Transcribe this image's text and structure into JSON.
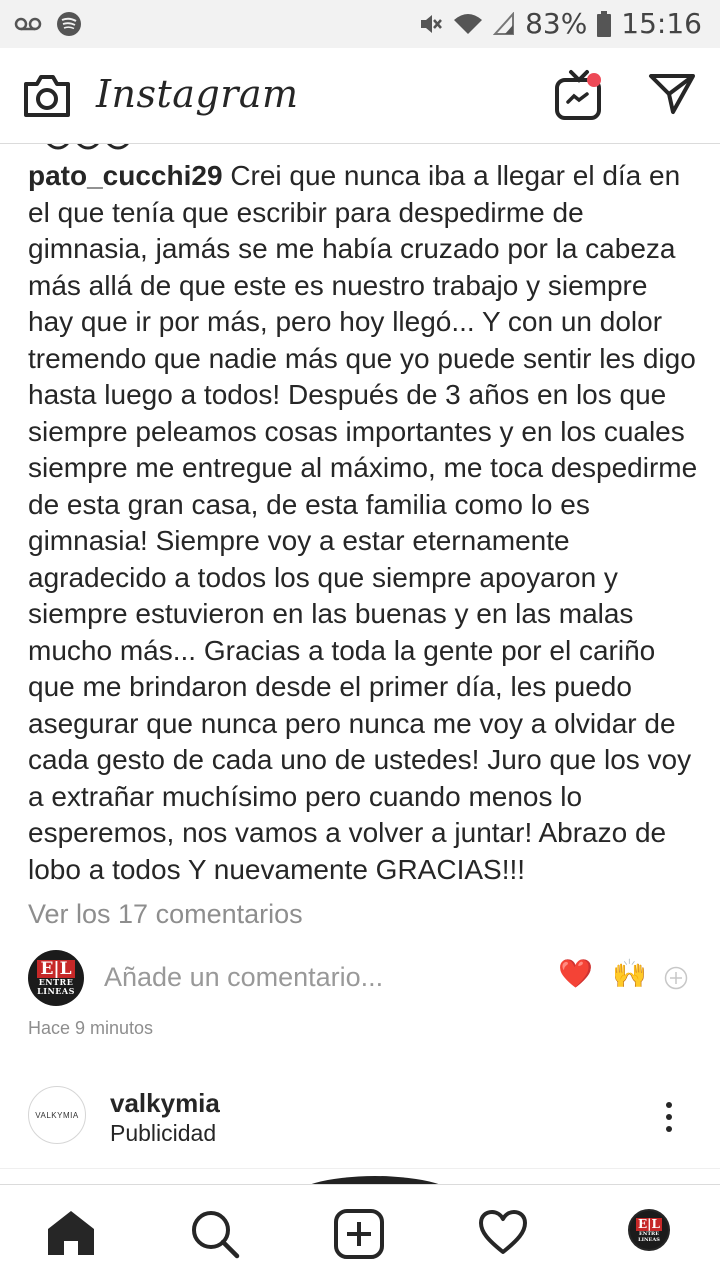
{
  "status_bar": {
    "battery": "83%",
    "time": "15:16",
    "icons": [
      "voicemail-icon",
      "spotify-icon",
      "mute-icon",
      "wifi-icon",
      "signal-icon",
      "battery-icon"
    ]
  },
  "app_bar": {
    "title": "Instagram",
    "icons": [
      "camera-icon",
      "igtv-icon",
      "direct-message-icon"
    ],
    "notification_color": "#ed4956"
  },
  "post": {
    "username": "pato_cucchi29",
    "caption": "Crei que nunca iba a llegar el día en el que tenía que escribir para despedirme de gimnasia, jamás se me había cruzado por la cabeza más allá de que este es nuestro trabajo y siempre hay que ir por más, pero hoy llegó... Y con un dolor tremendo que nadie más que yo puede sentir les digo hasta luego a todos! Después de 3 años en los que siempre peleamos cosas importantes y en los cuales siempre me entregue al máximo,  me toca despedirme de esta gran casa, de esta familia como lo es gimnasia! Siempre voy a estar eternamente agradecido a todos los que siempre apoyaron y siempre estuvieron en las buenas y en las malas mucho más... Gracias a toda la gente por el cariño que me brindaron desde el primer día, les puedo asegurar que nunca pero nunca me voy a olvidar de cada gesto de cada uno de ustedes! Juro que los voy a extrañar muchísimo pero cuando menos lo esperemos, nos vamos a volver a juntar! Abrazo de lobo a todos Y nuevamente GRACIAS!!!",
    "view_comments": "Ver los 17 comentarios",
    "comment_placeholder": "Añade un comentario...",
    "quick_reactions": [
      "❤️",
      "🙌"
    ],
    "time_ago": "Hace 9 minutos",
    "commenter_avatar": {
      "big": "E|L",
      "small": "ENTRE LINEAS"
    }
  },
  "next_post": {
    "avatar_text": "VALKYMIA",
    "username": "valkymia",
    "subtitle": "Publicidad"
  },
  "bottom_nav": {
    "items": [
      "home-icon",
      "search-icon",
      "new-post-icon",
      "activity-icon",
      "profile-avatar"
    ]
  },
  "colors": {
    "text": "#262626",
    "secondary_text": "#8e8e8e",
    "divider": "#dbdbdb",
    "status_bar_bg": "#f2f2f2"
  }
}
